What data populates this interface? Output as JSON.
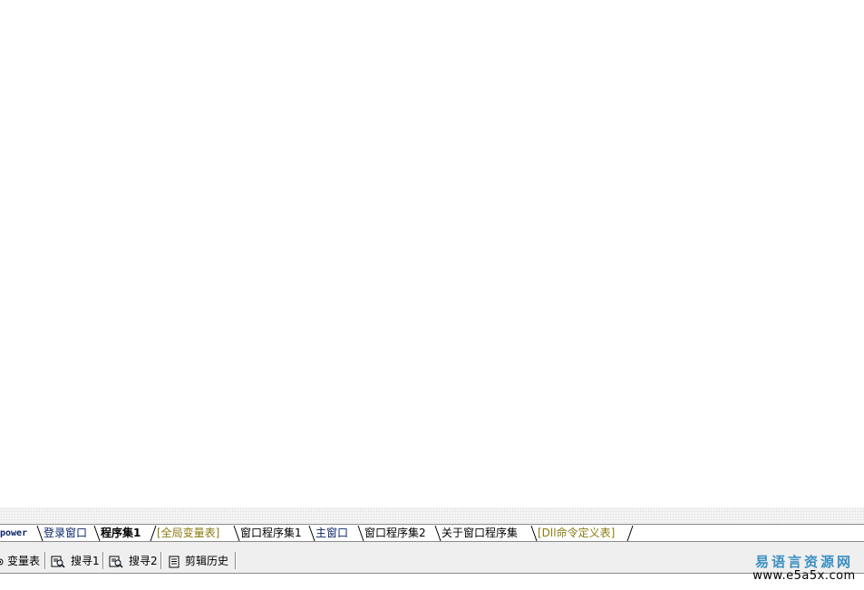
{
  "tabs": [
    {
      "label": "power",
      "style": "power"
    },
    {
      "label": "登录窗口",
      "style": "blue"
    },
    {
      "label": "程序集1",
      "style": "active"
    },
    {
      "label": "[全局变量表]",
      "style": "olive"
    },
    {
      "label": "窗口程序集1",
      "style": "black"
    },
    {
      "label": "主窗口",
      "style": "blue"
    },
    {
      "label": "窗口程序集2",
      "style": "black"
    },
    {
      "label": "关于窗口程序集",
      "style": "black"
    },
    {
      "label": "[Dll命令定义表]",
      "style": "olive"
    }
  ],
  "toolbar": {
    "vars_label": "变量表",
    "search1_label": "搜寻1",
    "search2_label": "搜寻2",
    "clip_label": "剪辑历史"
  },
  "brand": {
    "name": "易语言资源网",
    "url": "www.e5a5x.com"
  },
  "colors": {
    "tab_blue": "#0a246a",
    "tab_olive": "#8a7a10",
    "brand": "#3a8fc4"
  }
}
